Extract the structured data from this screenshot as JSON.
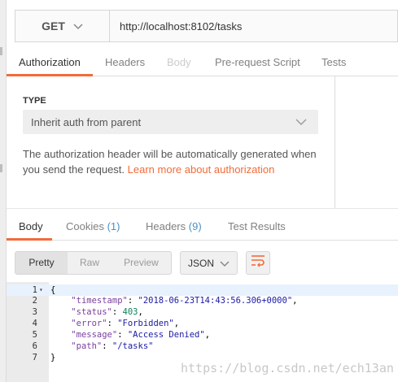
{
  "request": {
    "method": "GET",
    "url": "http://localhost:8102/tasks"
  },
  "request_tabs": [
    {
      "label": "Authorization",
      "state": "active"
    },
    {
      "label": "Headers",
      "state": "normal"
    },
    {
      "label": "Body",
      "state": "disabled"
    },
    {
      "label": "Pre-request Script",
      "state": "normal"
    },
    {
      "label": "Tests",
      "state": "normal"
    }
  ],
  "auth": {
    "type_label": "TYPE",
    "type_value": "Inherit auth from parent",
    "description": "The authorization header will be automatically generated when you send the request.",
    "link_text": "Learn more about authorization"
  },
  "response_tabs": [
    {
      "label": "Body",
      "count": "",
      "state": "active"
    },
    {
      "label": "Cookies",
      "count": "(1)",
      "state": "normal"
    },
    {
      "label": "Headers",
      "count": "(9)",
      "state": "normal"
    },
    {
      "label": "Test Results",
      "count": "",
      "state": "normal"
    }
  ],
  "response_toolbar": {
    "views": [
      "Pretty",
      "Raw",
      "Preview"
    ],
    "active_view": "Pretty",
    "format": "JSON"
  },
  "response_body": {
    "lines": [
      {
        "num": "1",
        "text": "{"
      },
      {
        "num": "2",
        "key": "\"timestamp\"",
        "value": "\"2018-06-23T14:43:56.306+0000\"",
        "kind": "string",
        "trail": ","
      },
      {
        "num": "3",
        "key": "\"status\"",
        "value": "403",
        "kind": "number",
        "trail": ","
      },
      {
        "num": "4",
        "key": "\"error\"",
        "value": "\"Forbidden\"",
        "kind": "string",
        "trail": ","
      },
      {
        "num": "5",
        "key": "\"message\"",
        "value": "\"Access Denied\"",
        "kind": "string",
        "trail": ","
      },
      {
        "num": "6",
        "key": "\"path\"",
        "value": "\"/tasks\"",
        "kind": "string",
        "trail": ""
      },
      {
        "num": "7",
        "text": "}"
      }
    ]
  },
  "watermark": "https://blog.csdn.net/ech13an",
  "colors": {
    "accent": "#f26b3a",
    "count": "#4a90c2",
    "json_key": "#7a3e9d",
    "json_string": "#1a1aa6",
    "json_number": "#098658"
  },
  "icons": {
    "method_dropdown": "chevron-down-icon",
    "auth_dropdown": "chevron-down-icon",
    "format_dropdown": "chevron-down-icon",
    "wrap": "wrap-lines-icon",
    "fold": "fold-arrow-icon"
  }
}
